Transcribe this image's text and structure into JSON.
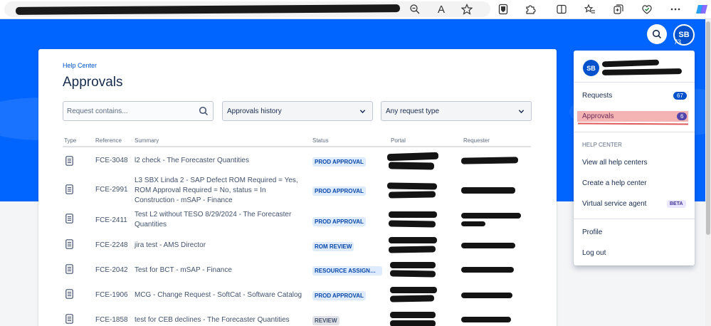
{
  "browser": {
    "toolbar_icons": [
      "zoom-out-icon",
      "read-aloud-icon",
      "favorite-star-icon",
      "bitwarden-extension-icon",
      "extensions-icon",
      "split-screen-icon",
      "favorites-icon",
      "collections-icon",
      "browser-essentials-icon",
      "more-icon",
      "copilot-icon"
    ],
    "read_aloud_glyph": "A"
  },
  "header": {
    "avatar_initials": "SB",
    "avatar_count": "73"
  },
  "page": {
    "breadcrumb": "Help Center",
    "title": "Approvals"
  },
  "filters": {
    "search_placeholder": "Request contains...",
    "history_select": "Approvals history",
    "type_select": "Any request type"
  },
  "table": {
    "columns": [
      "Type",
      "Reference",
      "Summary",
      "Status",
      "Portal",
      "Requester"
    ],
    "rows": [
      {
        "reference": "FCE-3048",
        "summary": "l2 check - The Forecaster Quantities",
        "status": "PROD APPROVAL",
        "status_color": "blue"
      },
      {
        "reference": "FCE-2991",
        "summary": "L3 SBX Linda 2 - SAP Defect ROM Required = Yes, ROM Approval Required = No, status = In Construction - mSAP - Finance",
        "status": "PROD APPROVAL",
        "status_color": "blue"
      },
      {
        "reference": "FCE-2411",
        "summary": "Test L2 without TESO 8/29/2024 - The Forecaster Quantities",
        "status": "PROD APPROVAL",
        "status_color": "blue"
      },
      {
        "reference": "FCE-2248",
        "summary": "jira test - AMS Director",
        "status": "ROM REVIEW",
        "status_color": "blue"
      },
      {
        "reference": "FCE-2042",
        "summary": "Test for BCT - mSAP - Finance",
        "status": "RESOURCE ASSIGNME...",
        "status_color": "blue"
      },
      {
        "reference": "FCE-1906",
        "summary": "MCG - Change Request - SoftCat - Software Catalog",
        "status": "PROD APPROVAL",
        "status_color": "blue"
      },
      {
        "reference": "FCE-1858",
        "summary": "test for CEB declines - The Forecaster Quantities",
        "status": "REVIEW",
        "status_color": "gray"
      }
    ]
  },
  "profile_menu": {
    "avatar_initials": "SB",
    "requests_label": "Requests",
    "requests_count": "67",
    "approvals_label": "Approvals",
    "approvals_count": "6",
    "help_center_heading": "HELP CENTER",
    "view_all": "View all help centers",
    "create": "Create a help center",
    "virtual_agent": "Virtual service agent",
    "beta": "BETA",
    "profile": "Profile",
    "logout": "Log out"
  },
  "colors": {
    "brand_blue": "#0065ff",
    "link_blue": "#0052cc",
    "highlight": "#f19b9b"
  }
}
